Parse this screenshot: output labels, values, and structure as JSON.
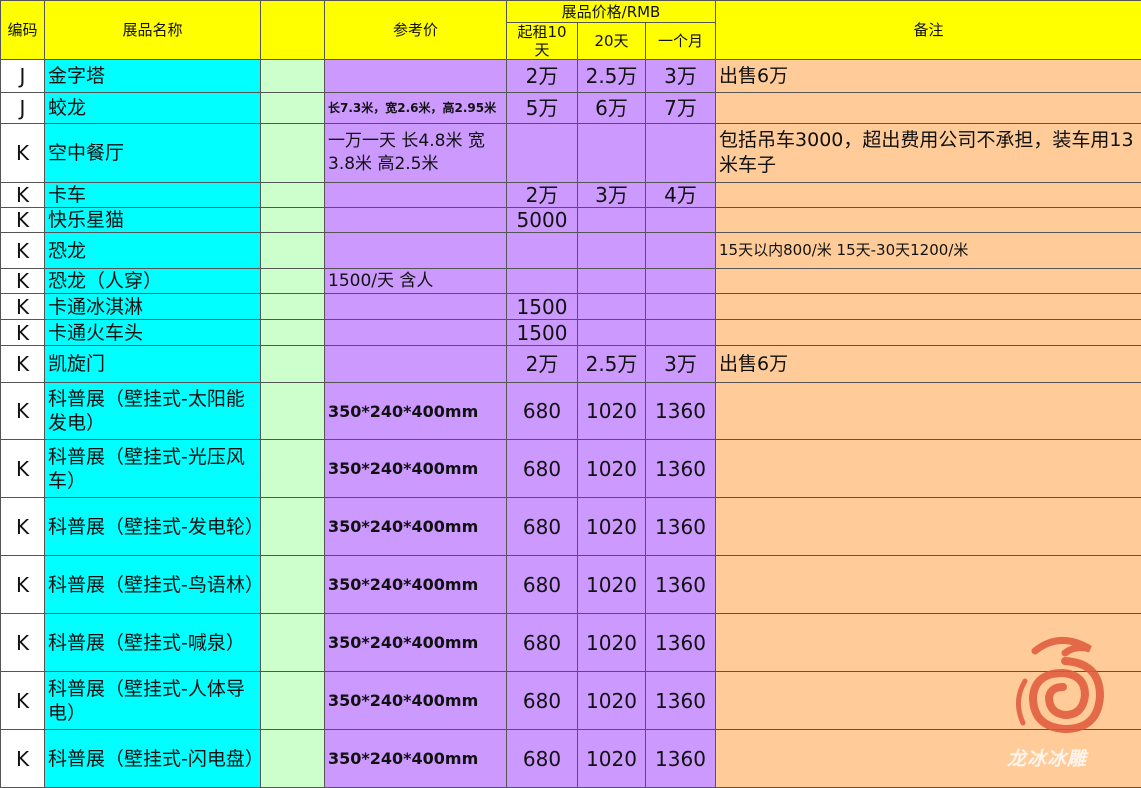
{
  "header": {
    "code": "编码",
    "name": "展品名称",
    "ref": "参考价",
    "price_group": "展品价格/RMB",
    "p1": "起租10天",
    "p2": "20天",
    "p3": "一个月",
    "note": "备注"
  },
  "rows": [
    {
      "code": "J",
      "name": "金字塔",
      "ref": "",
      "p1": "2万",
      "p2": "2.5万",
      "p3": "3万",
      "note": "出售6万"
    },
    {
      "code": "J",
      "name": "蛟龙",
      "ref": "长7.3米，宽2.6米，高2.95米",
      "p1": "5万",
      "p2": "6万",
      "p3": "7万",
      "note": ""
    },
    {
      "code": "K",
      "name": "空中餐厅",
      "ref": "一万一天 长4.8米 宽3.8米 高2.5米",
      "p1": "",
      "p2": "",
      "p3": "",
      "note": "包括吊车3000，超出费用公司不承担，装车用13米车子"
    },
    {
      "code": "K",
      "name": "卡车",
      "ref": "",
      "p1": "2万",
      "p2": "3万",
      "p3": "4万",
      "note": ""
    },
    {
      "code": "K",
      "name": "快乐星猫",
      "ref": "",
      "p1": "5000",
      "p2": "",
      "p3": "",
      "note": ""
    },
    {
      "code": "K",
      "name": "恐龙",
      "ref": "",
      "p1": "",
      "p2": "",
      "p3": "",
      "note": "15天以内800/米 15天-30天1200/米"
    },
    {
      "code": "K",
      "name": "恐龙（人穿）",
      "ref": "1500/天 含人",
      "p1": "",
      "p2": "",
      "p3": "",
      "note": ""
    },
    {
      "code": "K",
      "name": "卡通冰淇淋",
      "ref": "",
      "p1": "1500",
      "p2": "",
      "p3": "",
      "note": ""
    },
    {
      "code": "K",
      "name": "卡通火车头",
      "ref": "",
      "p1": "1500",
      "p2": "",
      "p3": "",
      "note": ""
    },
    {
      "code": "K",
      "name": "凯旋门",
      "ref": "",
      "p1": "2万",
      "p2": "2.5万",
      "p3": "3万",
      "note": "出售6万"
    },
    {
      "code": "K",
      "name": "科普展（壁挂式-太阳能发电）",
      "ref": "350*240*400mm",
      "p1": "680",
      "p2": "1020",
      "p3": "1360",
      "note": ""
    },
    {
      "code": "K",
      "name": "科普展（壁挂式-光压风车）",
      "ref": "350*240*400mm",
      "p1": "680",
      "p2": "1020",
      "p3": "1360",
      "note": ""
    },
    {
      "code": "K",
      "name": "科普展（壁挂式-发电轮）",
      "ref": "350*240*400mm",
      "p1": "680",
      "p2": "1020",
      "p3": "1360",
      "note": ""
    },
    {
      "code": "K",
      "name": "科普展（壁挂式-鸟语林）",
      "ref": "350*240*400mm",
      "p1": "680",
      "p2": "1020",
      "p3": "1360",
      "note": ""
    },
    {
      "code": "K",
      "name": "科普展（壁挂式-喊泉）",
      "ref": "350*240*400mm",
      "p1": "680",
      "p2": "1020",
      "p3": "1360",
      "note": ""
    },
    {
      "code": "K",
      "name": "科普展（壁挂式-人体导电）",
      "ref": "350*240*400mm",
      "p1": "680",
      "p2": "1020",
      "p3": "1360",
      "note": ""
    },
    {
      "code": "K",
      "name": "科普展（壁挂式-闪电盘）",
      "ref": "350*240*400mm",
      "p1": "680",
      "p2": "1020",
      "p3": "1360",
      "note": ""
    }
  ],
  "watermark": {
    "text": "龙冰冰雕",
    "icon": "dragon-spiral-logo",
    "color": "#e0583a"
  }
}
